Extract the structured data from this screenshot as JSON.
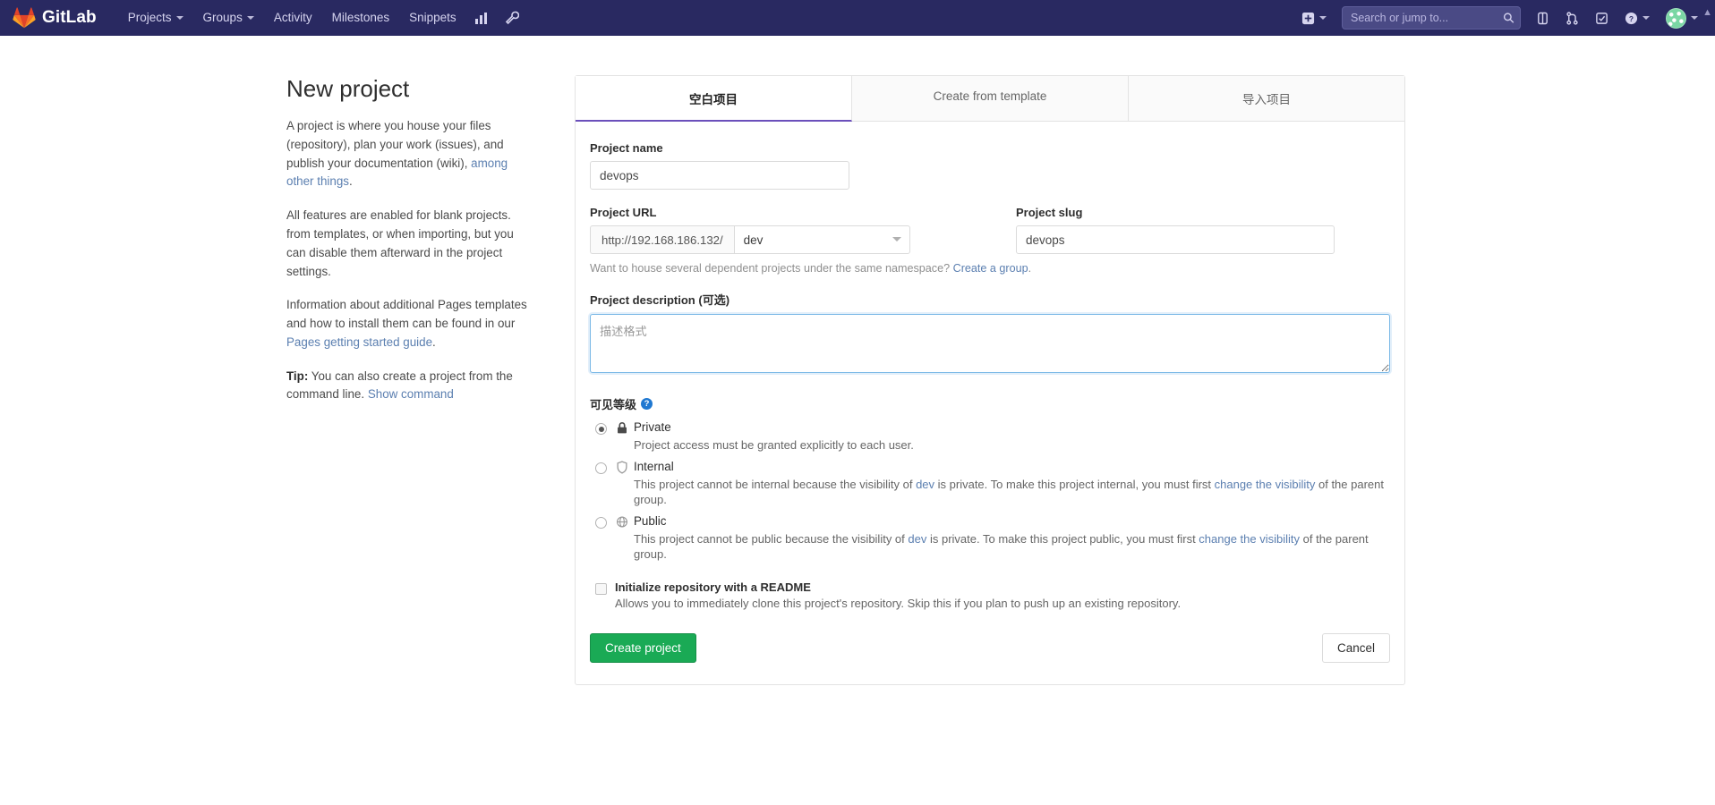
{
  "navbar": {
    "brand": "GitLab",
    "links": [
      {
        "label": "Projects",
        "caret": true,
        "name": "nav-projects"
      },
      {
        "label": "Groups",
        "caret": true,
        "name": "nav-groups"
      },
      {
        "label": "Activity",
        "caret": false,
        "name": "nav-activity"
      },
      {
        "label": "Milestones",
        "caret": false,
        "name": "nav-milestones"
      },
      {
        "label": "Snippets",
        "caret": false,
        "name": "nav-snippets"
      }
    ],
    "icons": {
      "analytics": "analytics-chart-icon",
      "wrench": "wrench-admin-icon",
      "plus": "plus-icon",
      "issues": "issues-icon",
      "merge_requests": "merge-requests-icon",
      "todos": "todos-checkbox-icon",
      "help": "help-question-icon",
      "avatar": "user-avatar"
    },
    "search": {
      "placeholder": "Search or jump to...",
      "value": "",
      "icon": "search-icon"
    }
  },
  "aside": {
    "title": "New project",
    "p1_a": "A project is where you house your files (repository), plan your work (issues), and publish your documentation (wiki), ",
    "p1_link": "among other things",
    "p1_b": ".",
    "p2": "All features are enabled for blank projects. from templates, or when importing, but you can disable them afterward in the project settings.",
    "p3_a": "Information about additional Pages templates and how to install them can be found in our ",
    "p3_link": "Pages getting started guide",
    "p3_b": ".",
    "tip_label": "Tip:",
    "tip_text": " You can also create a project from the command line. ",
    "tip_link": "Show command"
  },
  "tabs": [
    {
      "label": "空白项目",
      "active": true,
      "name": "tab-blank-project"
    },
    {
      "label": "Create from template",
      "active": false,
      "name": "tab-create-from-template"
    },
    {
      "label": "导入项目",
      "active": false,
      "name": "tab-import-project"
    }
  ],
  "form": {
    "project_name_label": "Project name",
    "project_name_value": "devops",
    "project_name_placeholder": "",
    "project_url_label": "Project URL",
    "project_url_prefix": "http://192.168.186.132/",
    "namespace_selected": "dev",
    "namespace_options": [
      "dev"
    ],
    "project_slug_label": "Project slug",
    "project_slug_value": "devops",
    "namespace_helper_text": "Want to house several dependent projects under the same namespace? ",
    "namespace_helper_link": "Create a group",
    "namespace_helper_end": ".",
    "description_label": "Project description (可选)",
    "description_value": "",
    "description_placeholder": "描述格式",
    "visibility_label": "可见等级",
    "visibility_help_glyph": "?",
    "visibility": [
      {
        "id": "private",
        "title": "Private",
        "icon": "lock-icon",
        "selected": true,
        "desc_a": "Project access must be granted explicitly to each user.",
        "desc_link": "",
        "desc_b": ""
      },
      {
        "id": "internal",
        "title": "Internal",
        "icon": "shield-icon",
        "selected": false,
        "desc_a": "This project cannot be internal because the visibility of ",
        "desc_group": "dev",
        "desc_mid": " is private. To make this project internal, you must first ",
        "desc_link": "change the visibility",
        "desc_b": " of the parent group."
      },
      {
        "id": "public",
        "title": "Public",
        "icon": "globe-icon",
        "selected": false,
        "desc_a": "This project cannot be public because the visibility of ",
        "desc_group": "dev",
        "desc_mid": " is private. To make this project public, you must first ",
        "desc_link": "change the visibility",
        "desc_b": " of the parent group."
      }
    ],
    "readme_checked": false,
    "readme_title": "Initialize repository with a README",
    "readme_desc": "Allows you to immediately clone this project's repository. Skip this if you plan to push up an existing repository.",
    "create_button": "Create project",
    "cancel_button": "Cancel"
  },
  "colors": {
    "navbar_bg": "#292961",
    "accent": "#6b4fbb",
    "primary_button": "#1aaa55",
    "link": "#5b7fb0"
  }
}
